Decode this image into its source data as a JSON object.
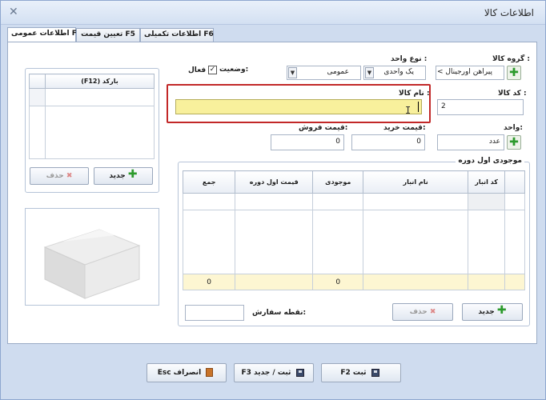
{
  "window": {
    "title": "اطلاعات کالا",
    "close_icon": "close-icon"
  },
  "tabs": [
    {
      "label": "اطلاعات تکمیلی F6"
    },
    {
      "label": "تعیین قیمت F5"
    },
    {
      "label": "اطلاعات عمومی F4"
    }
  ],
  "form": {
    "group": {
      "label": "گروه کالا :",
      "value": "پیراهن اورجینال > پ"
    },
    "unit_type": {
      "label": "نوع واحد :",
      "value1": "یک واحدی",
      "value2": "عمومی"
    },
    "status": {
      "label": "وضعیت:",
      "check_label": "فعال",
      "checked": "✓"
    },
    "code": {
      "label": "کد کالا :",
      "value": "2"
    },
    "name": {
      "label": "نام کالا :",
      "value": ""
    },
    "unit": {
      "label": "واحد:",
      "value": "عدد"
    },
    "buy_price": {
      "label": "قیمت خرید:",
      "value": "0"
    },
    "sell_price": {
      "label": "قیمت فروش:",
      "value": "0"
    },
    "reorder": {
      "label": "نقطه سفارش:",
      "value": ""
    }
  },
  "barcode": {
    "header": "(F12) بارکد",
    "new_button": "جدید",
    "delete_button": "حذف"
  },
  "inventory": {
    "title": "موجودی اول دوره",
    "columns": [
      "کد انبار",
      "نام انبار",
      "موجودی",
      "قیمت اول دوره",
      "جمع"
    ],
    "footer": [
      "",
      "",
      "0",
      "",
      "0"
    ],
    "new_button": "جدید",
    "delete_button": "حذف"
  },
  "footer_buttons": {
    "save": "ثبت F2",
    "save_new": "ثبت / جدید F3",
    "cancel": "انصراف Esc"
  },
  "colors": {
    "highlight": "#f8f09c",
    "focus_border": "#c22828",
    "accent_green": "#2c9a2c"
  }
}
